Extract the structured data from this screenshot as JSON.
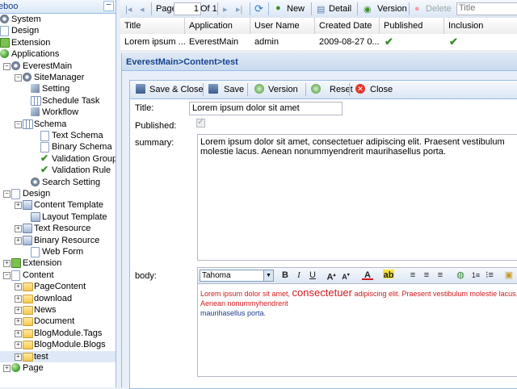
{
  "tree": {
    "header": "eboo",
    "collapse_label": "−",
    "items": [
      {
        "label": "System",
        "icon": "gear-icon"
      },
      {
        "label": "Design",
        "icon": "page-icon"
      },
      {
        "label": "Extension",
        "icon": "puzzle-icon"
      },
      {
        "label": "Applications",
        "icon": "globe-icon"
      },
      {
        "label": "EverestMain",
        "icon": "site-icon"
      },
      {
        "label": "SiteManager",
        "icon": "gear-icon"
      },
      {
        "label": "Setting",
        "icon": "tool-icon"
      },
      {
        "label": "Schedule Task",
        "icon": "grid-icon"
      },
      {
        "label": "Workflow",
        "icon": "workflow-icon"
      },
      {
        "label": "Schema",
        "icon": "grid-icon"
      },
      {
        "label": "Text Schema",
        "icon": "page-icon"
      },
      {
        "label": "Binary Schema",
        "icon": "page-icon"
      },
      {
        "label": "Validation Group",
        "icon": "check-icon"
      },
      {
        "label": "Validation Rule",
        "icon": "check-icon"
      },
      {
        "label": "Search Setting",
        "icon": "search-icon"
      },
      {
        "label": "Design",
        "icon": "page-icon"
      },
      {
        "label": "Content Template",
        "icon": "res-icon"
      },
      {
        "label": "Layout Template",
        "icon": "res-icon"
      },
      {
        "label": "Text Resource",
        "icon": "res-icon"
      },
      {
        "label": "Binary Resource",
        "icon": "res-icon"
      },
      {
        "label": "Web Form",
        "icon": "page-icon"
      },
      {
        "label": "Extension",
        "icon": "puzzle-icon"
      },
      {
        "label": "Content",
        "icon": "page-icon"
      },
      {
        "label": "PageContent",
        "icon": "folder-icon"
      },
      {
        "label": "download",
        "icon": "folder-icon"
      },
      {
        "label": "News",
        "icon": "folder-icon"
      },
      {
        "label": "Document",
        "icon": "folder-icon"
      },
      {
        "label": "BlogModule.Tags",
        "icon": "folder-icon"
      },
      {
        "label": "BlogModule.Blogs",
        "icon": "folder-icon"
      },
      {
        "label": "test",
        "icon": "folder-icon"
      },
      {
        "label": "Page",
        "icon": "globe-icon"
      }
    ]
  },
  "grid_toolbar": {
    "page_label": "Page",
    "page_value": "1",
    "of_label": "Of 1",
    "new_label": "New",
    "detail_label": "Detail",
    "version_label": "Version",
    "delete_label": "Delete",
    "title_placeholder": "Title"
  },
  "grid": {
    "columns": [
      "Title",
      "Application",
      "User Name",
      "Created Date",
      "Published",
      "Inclusion"
    ],
    "row": {
      "title": "Lorem ipsum ...",
      "application": "EverestMain",
      "user": "admin",
      "created": "2009-08-27 0...",
      "published": "✔",
      "inclusion": "✔"
    }
  },
  "editor": {
    "breadcrumb": "EverestMain>Content>test",
    "toolbar": {
      "save_close": "Save & Close",
      "save": "Save",
      "version": "Version",
      "reset": "Reset",
      "close": "Close"
    },
    "fields": {
      "title_label": "Title:",
      "title_value": "Lorem ipsum dolor sit amet",
      "published_label": "Published:",
      "summary_label": "summary:",
      "summary_value": "Lorem ipsum dolor sit amet, consectetuer adipiscing elit. Praesent vestibulum molestie lacus. Aenean nonummyendrerit maurihasellus porta.",
      "body_label": "body:"
    },
    "rte": {
      "font": "Tahoma",
      "body_part1": "Lorem ipsum dolor sit amet, ",
      "body_big": "consectetuer",
      "body_part2": " adipiscing elit. Praesent vestibulum molestie lacus. Aenean nonummyhendrerit",
      "body_part3": "maurihasellus porta."
    }
  },
  "colors": {
    "border": "#99bbe8",
    "header_text": "#15428b",
    "selected_row": "#dfe8f6",
    "check": "#3a8f2c",
    "rte_red": "#d2191d"
  }
}
